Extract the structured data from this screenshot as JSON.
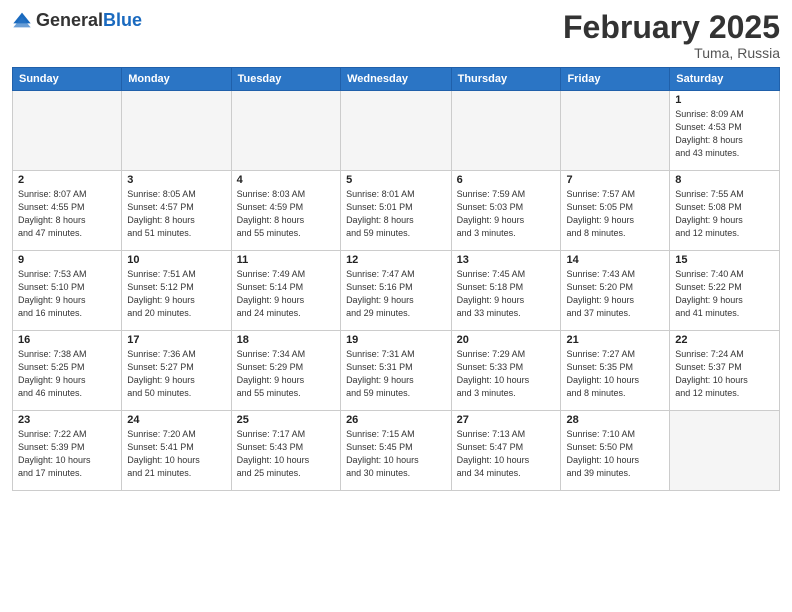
{
  "header": {
    "logo_general": "General",
    "logo_blue": "Blue",
    "title": "February 2025",
    "location": "Tuma, Russia"
  },
  "days_of_week": [
    "Sunday",
    "Monday",
    "Tuesday",
    "Wednesday",
    "Thursday",
    "Friday",
    "Saturday"
  ],
  "weeks": [
    [
      {
        "day": "",
        "info": ""
      },
      {
        "day": "",
        "info": ""
      },
      {
        "day": "",
        "info": ""
      },
      {
        "day": "",
        "info": ""
      },
      {
        "day": "",
        "info": ""
      },
      {
        "day": "",
        "info": ""
      },
      {
        "day": "1",
        "info": "Sunrise: 8:09 AM\nSunset: 4:53 PM\nDaylight: 8 hours\nand 43 minutes."
      }
    ],
    [
      {
        "day": "2",
        "info": "Sunrise: 8:07 AM\nSunset: 4:55 PM\nDaylight: 8 hours\nand 47 minutes."
      },
      {
        "day": "3",
        "info": "Sunrise: 8:05 AM\nSunset: 4:57 PM\nDaylight: 8 hours\nand 51 minutes."
      },
      {
        "day": "4",
        "info": "Sunrise: 8:03 AM\nSunset: 4:59 PM\nDaylight: 8 hours\nand 55 minutes."
      },
      {
        "day": "5",
        "info": "Sunrise: 8:01 AM\nSunset: 5:01 PM\nDaylight: 8 hours\nand 59 minutes."
      },
      {
        "day": "6",
        "info": "Sunrise: 7:59 AM\nSunset: 5:03 PM\nDaylight: 9 hours\nand 3 minutes."
      },
      {
        "day": "7",
        "info": "Sunrise: 7:57 AM\nSunset: 5:05 PM\nDaylight: 9 hours\nand 8 minutes."
      },
      {
        "day": "8",
        "info": "Sunrise: 7:55 AM\nSunset: 5:08 PM\nDaylight: 9 hours\nand 12 minutes."
      }
    ],
    [
      {
        "day": "9",
        "info": "Sunrise: 7:53 AM\nSunset: 5:10 PM\nDaylight: 9 hours\nand 16 minutes."
      },
      {
        "day": "10",
        "info": "Sunrise: 7:51 AM\nSunset: 5:12 PM\nDaylight: 9 hours\nand 20 minutes."
      },
      {
        "day": "11",
        "info": "Sunrise: 7:49 AM\nSunset: 5:14 PM\nDaylight: 9 hours\nand 24 minutes."
      },
      {
        "day": "12",
        "info": "Sunrise: 7:47 AM\nSunset: 5:16 PM\nDaylight: 9 hours\nand 29 minutes."
      },
      {
        "day": "13",
        "info": "Sunrise: 7:45 AM\nSunset: 5:18 PM\nDaylight: 9 hours\nand 33 minutes."
      },
      {
        "day": "14",
        "info": "Sunrise: 7:43 AM\nSunset: 5:20 PM\nDaylight: 9 hours\nand 37 minutes."
      },
      {
        "day": "15",
        "info": "Sunrise: 7:40 AM\nSunset: 5:22 PM\nDaylight: 9 hours\nand 41 minutes."
      }
    ],
    [
      {
        "day": "16",
        "info": "Sunrise: 7:38 AM\nSunset: 5:25 PM\nDaylight: 9 hours\nand 46 minutes."
      },
      {
        "day": "17",
        "info": "Sunrise: 7:36 AM\nSunset: 5:27 PM\nDaylight: 9 hours\nand 50 minutes."
      },
      {
        "day": "18",
        "info": "Sunrise: 7:34 AM\nSunset: 5:29 PM\nDaylight: 9 hours\nand 55 minutes."
      },
      {
        "day": "19",
        "info": "Sunrise: 7:31 AM\nSunset: 5:31 PM\nDaylight: 9 hours\nand 59 minutes."
      },
      {
        "day": "20",
        "info": "Sunrise: 7:29 AM\nSunset: 5:33 PM\nDaylight: 10 hours\nand 3 minutes."
      },
      {
        "day": "21",
        "info": "Sunrise: 7:27 AM\nSunset: 5:35 PM\nDaylight: 10 hours\nand 8 minutes."
      },
      {
        "day": "22",
        "info": "Sunrise: 7:24 AM\nSunset: 5:37 PM\nDaylight: 10 hours\nand 12 minutes."
      }
    ],
    [
      {
        "day": "23",
        "info": "Sunrise: 7:22 AM\nSunset: 5:39 PM\nDaylight: 10 hours\nand 17 minutes."
      },
      {
        "day": "24",
        "info": "Sunrise: 7:20 AM\nSunset: 5:41 PM\nDaylight: 10 hours\nand 21 minutes."
      },
      {
        "day": "25",
        "info": "Sunrise: 7:17 AM\nSunset: 5:43 PM\nDaylight: 10 hours\nand 25 minutes."
      },
      {
        "day": "26",
        "info": "Sunrise: 7:15 AM\nSunset: 5:45 PM\nDaylight: 10 hours\nand 30 minutes."
      },
      {
        "day": "27",
        "info": "Sunrise: 7:13 AM\nSunset: 5:47 PM\nDaylight: 10 hours\nand 34 minutes."
      },
      {
        "day": "28",
        "info": "Sunrise: 7:10 AM\nSunset: 5:50 PM\nDaylight: 10 hours\nand 39 minutes."
      },
      {
        "day": "",
        "info": ""
      }
    ]
  ]
}
